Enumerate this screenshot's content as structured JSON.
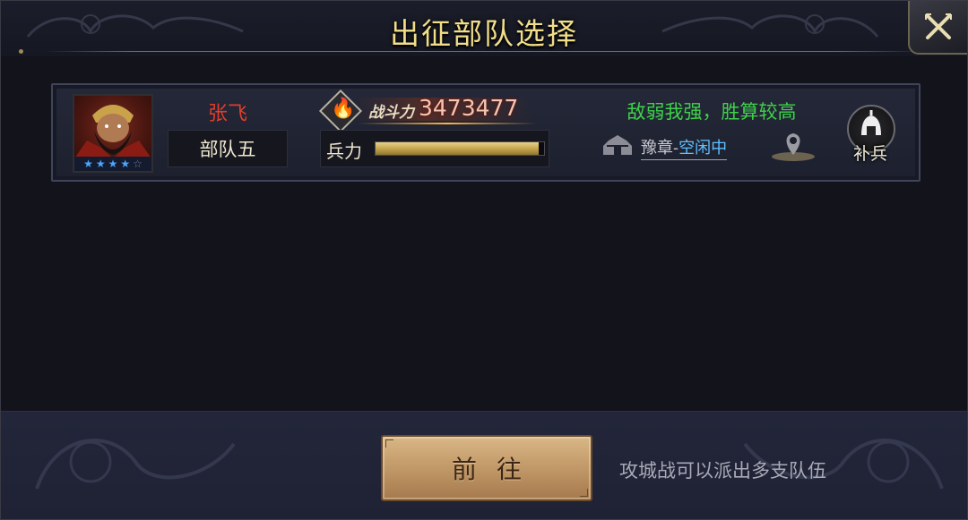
{
  "dialog": {
    "title": "出征部队选择"
  },
  "troop": {
    "hero_name": "张飞",
    "troop_name": "部队五",
    "stars_filled": 4,
    "stars_total": 5,
    "power_label": "战斗力",
    "power_value": "3473477",
    "troops_label": "兵力",
    "troops_fraction": 0.97,
    "forecast": "敌弱我强，胜算较高",
    "location_city": "豫章",
    "location_sep": "-",
    "location_status": "空闲中",
    "reinforce_label": "补兵"
  },
  "footer": {
    "go_label": "前往",
    "hint": "攻城战可以派出多支队伍"
  },
  "colors": {
    "title": "#f1dd8a",
    "hero_name": "#e03e2c",
    "forecast": "#3fd14a",
    "status": "#5fbfff"
  },
  "icons": [
    "close-icon",
    "fire-icon",
    "city-icon",
    "location-pin-icon",
    "helmet-icon"
  ]
}
